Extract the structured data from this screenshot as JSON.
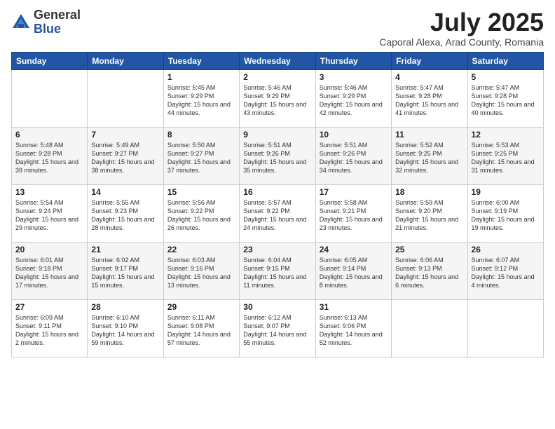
{
  "logo": {
    "general": "General",
    "blue": "Blue"
  },
  "title": {
    "month": "July 2025",
    "location": "Caporal Alexa, Arad County, Romania"
  },
  "days_of_week": [
    "Sunday",
    "Monday",
    "Tuesday",
    "Wednesday",
    "Thursday",
    "Friday",
    "Saturday"
  ],
  "weeks": [
    [
      {
        "day": "",
        "info": ""
      },
      {
        "day": "",
        "info": ""
      },
      {
        "day": "1",
        "info": "Sunrise: 5:45 AM\nSunset: 9:29 PM\nDaylight: 15 hours and 44 minutes."
      },
      {
        "day": "2",
        "info": "Sunrise: 5:46 AM\nSunset: 9:29 PM\nDaylight: 15 hours and 43 minutes."
      },
      {
        "day": "3",
        "info": "Sunrise: 5:46 AM\nSunset: 9:29 PM\nDaylight: 15 hours and 42 minutes."
      },
      {
        "day": "4",
        "info": "Sunrise: 5:47 AM\nSunset: 9:28 PM\nDaylight: 15 hours and 41 minutes."
      },
      {
        "day": "5",
        "info": "Sunrise: 5:47 AM\nSunset: 9:28 PM\nDaylight: 15 hours and 40 minutes."
      }
    ],
    [
      {
        "day": "6",
        "info": "Sunrise: 5:48 AM\nSunset: 9:28 PM\nDaylight: 15 hours and 39 minutes."
      },
      {
        "day": "7",
        "info": "Sunrise: 5:49 AM\nSunset: 9:27 PM\nDaylight: 15 hours and 38 minutes."
      },
      {
        "day": "8",
        "info": "Sunrise: 5:50 AM\nSunset: 9:27 PM\nDaylight: 15 hours and 37 minutes."
      },
      {
        "day": "9",
        "info": "Sunrise: 5:51 AM\nSunset: 9:26 PM\nDaylight: 15 hours and 35 minutes."
      },
      {
        "day": "10",
        "info": "Sunrise: 5:51 AM\nSunset: 9:26 PM\nDaylight: 15 hours and 34 minutes."
      },
      {
        "day": "11",
        "info": "Sunrise: 5:52 AM\nSunset: 9:25 PM\nDaylight: 15 hours and 32 minutes."
      },
      {
        "day": "12",
        "info": "Sunrise: 5:53 AM\nSunset: 9:25 PM\nDaylight: 15 hours and 31 minutes."
      }
    ],
    [
      {
        "day": "13",
        "info": "Sunrise: 5:54 AM\nSunset: 9:24 PM\nDaylight: 15 hours and 29 minutes."
      },
      {
        "day": "14",
        "info": "Sunrise: 5:55 AM\nSunset: 9:23 PM\nDaylight: 15 hours and 28 minutes."
      },
      {
        "day": "15",
        "info": "Sunrise: 5:56 AM\nSunset: 9:22 PM\nDaylight: 15 hours and 26 minutes."
      },
      {
        "day": "16",
        "info": "Sunrise: 5:57 AM\nSunset: 9:22 PM\nDaylight: 15 hours and 24 minutes."
      },
      {
        "day": "17",
        "info": "Sunrise: 5:58 AM\nSunset: 9:21 PM\nDaylight: 15 hours and 23 minutes."
      },
      {
        "day": "18",
        "info": "Sunrise: 5:59 AM\nSunset: 9:20 PM\nDaylight: 15 hours and 21 minutes."
      },
      {
        "day": "19",
        "info": "Sunrise: 6:00 AM\nSunset: 9:19 PM\nDaylight: 15 hours and 19 minutes."
      }
    ],
    [
      {
        "day": "20",
        "info": "Sunrise: 6:01 AM\nSunset: 9:18 PM\nDaylight: 15 hours and 17 minutes."
      },
      {
        "day": "21",
        "info": "Sunrise: 6:02 AM\nSunset: 9:17 PM\nDaylight: 15 hours and 15 minutes."
      },
      {
        "day": "22",
        "info": "Sunrise: 6:03 AM\nSunset: 9:16 PM\nDaylight: 15 hours and 13 minutes."
      },
      {
        "day": "23",
        "info": "Sunrise: 6:04 AM\nSunset: 9:15 PM\nDaylight: 15 hours and 11 minutes."
      },
      {
        "day": "24",
        "info": "Sunrise: 6:05 AM\nSunset: 9:14 PM\nDaylight: 15 hours and 8 minutes."
      },
      {
        "day": "25",
        "info": "Sunrise: 6:06 AM\nSunset: 9:13 PM\nDaylight: 15 hours and 6 minutes."
      },
      {
        "day": "26",
        "info": "Sunrise: 6:07 AM\nSunset: 9:12 PM\nDaylight: 15 hours and 4 minutes."
      }
    ],
    [
      {
        "day": "27",
        "info": "Sunrise: 6:09 AM\nSunset: 9:11 PM\nDaylight: 15 hours and 2 minutes."
      },
      {
        "day": "28",
        "info": "Sunrise: 6:10 AM\nSunset: 9:10 PM\nDaylight: 14 hours and 59 minutes."
      },
      {
        "day": "29",
        "info": "Sunrise: 6:11 AM\nSunset: 9:08 PM\nDaylight: 14 hours and 57 minutes."
      },
      {
        "day": "30",
        "info": "Sunrise: 6:12 AM\nSunset: 9:07 PM\nDaylight: 14 hours and 55 minutes."
      },
      {
        "day": "31",
        "info": "Sunrise: 6:13 AM\nSunset: 9:06 PM\nDaylight: 14 hours and 52 minutes."
      },
      {
        "day": "",
        "info": ""
      },
      {
        "day": "",
        "info": ""
      }
    ]
  ]
}
